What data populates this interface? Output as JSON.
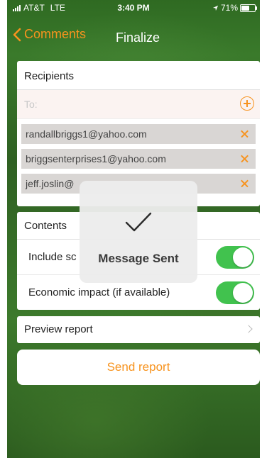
{
  "status_bar": {
    "carrier": "AT&T",
    "network": "LTE",
    "time": "3:40 PM",
    "battery_percent": "71%",
    "battery_level": 0.71
  },
  "nav": {
    "back_label": "Comments",
    "title": "Finalize"
  },
  "recipients": {
    "header": "Recipients",
    "to_placeholder": "To:",
    "emails": [
      "randallbriggs1@yahoo.com",
      "briggsenterprises1@yahoo.com",
      "jeff.joslin@"
    ]
  },
  "contents": {
    "header": "Contents",
    "options": [
      {
        "label": "Include sc",
        "enabled": true
      },
      {
        "label": "Economic impact (if available)",
        "enabled": true
      }
    ]
  },
  "preview_label": "Preview report",
  "send_label": "Send report",
  "hud": {
    "message": "Message Sent"
  },
  "colors": {
    "accent": "#f7931e",
    "toggle_on": "#41c24e",
    "chip_bg": "#d9d6d4"
  }
}
